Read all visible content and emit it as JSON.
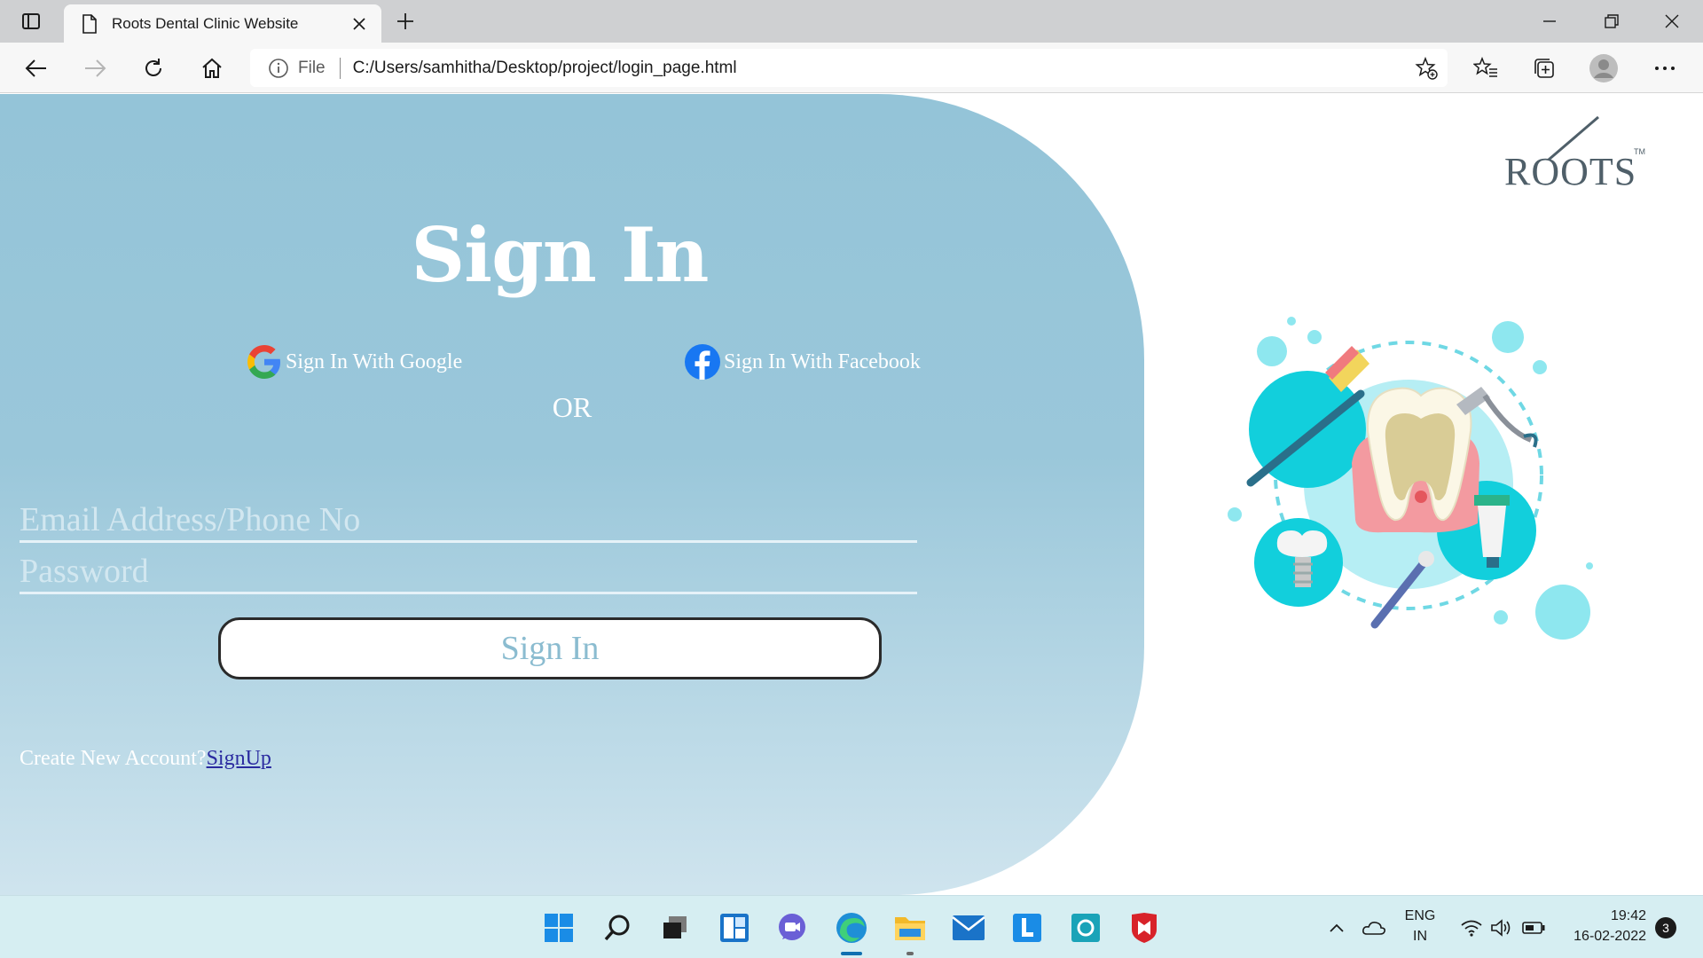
{
  "browser": {
    "tab_title": "Roots Dental Clinic Website",
    "address_prefix": "File",
    "url": "C:/Users/samhitha/Desktop/project/login_page.html"
  },
  "page": {
    "heading": "Sign In",
    "google_label": "Sign In With Google",
    "facebook_label": "Sign In With Facebook",
    "or_label": "OR",
    "email_placeholder": "Email Address/Phone No",
    "password_placeholder": "Password",
    "submit_label": "Sign In",
    "create_account_text": "Create New Account?",
    "signup_link": "SignUp",
    "logo_text": "ROOTS"
  },
  "taskbar": {
    "language": "ENG",
    "region": "IN",
    "time": "19:42",
    "date": "16-02-2022",
    "notification_count": "3"
  },
  "colors": {
    "panel": "#94c4d8",
    "taskbar": "#d6eef2",
    "link": "#2a2aa0"
  }
}
